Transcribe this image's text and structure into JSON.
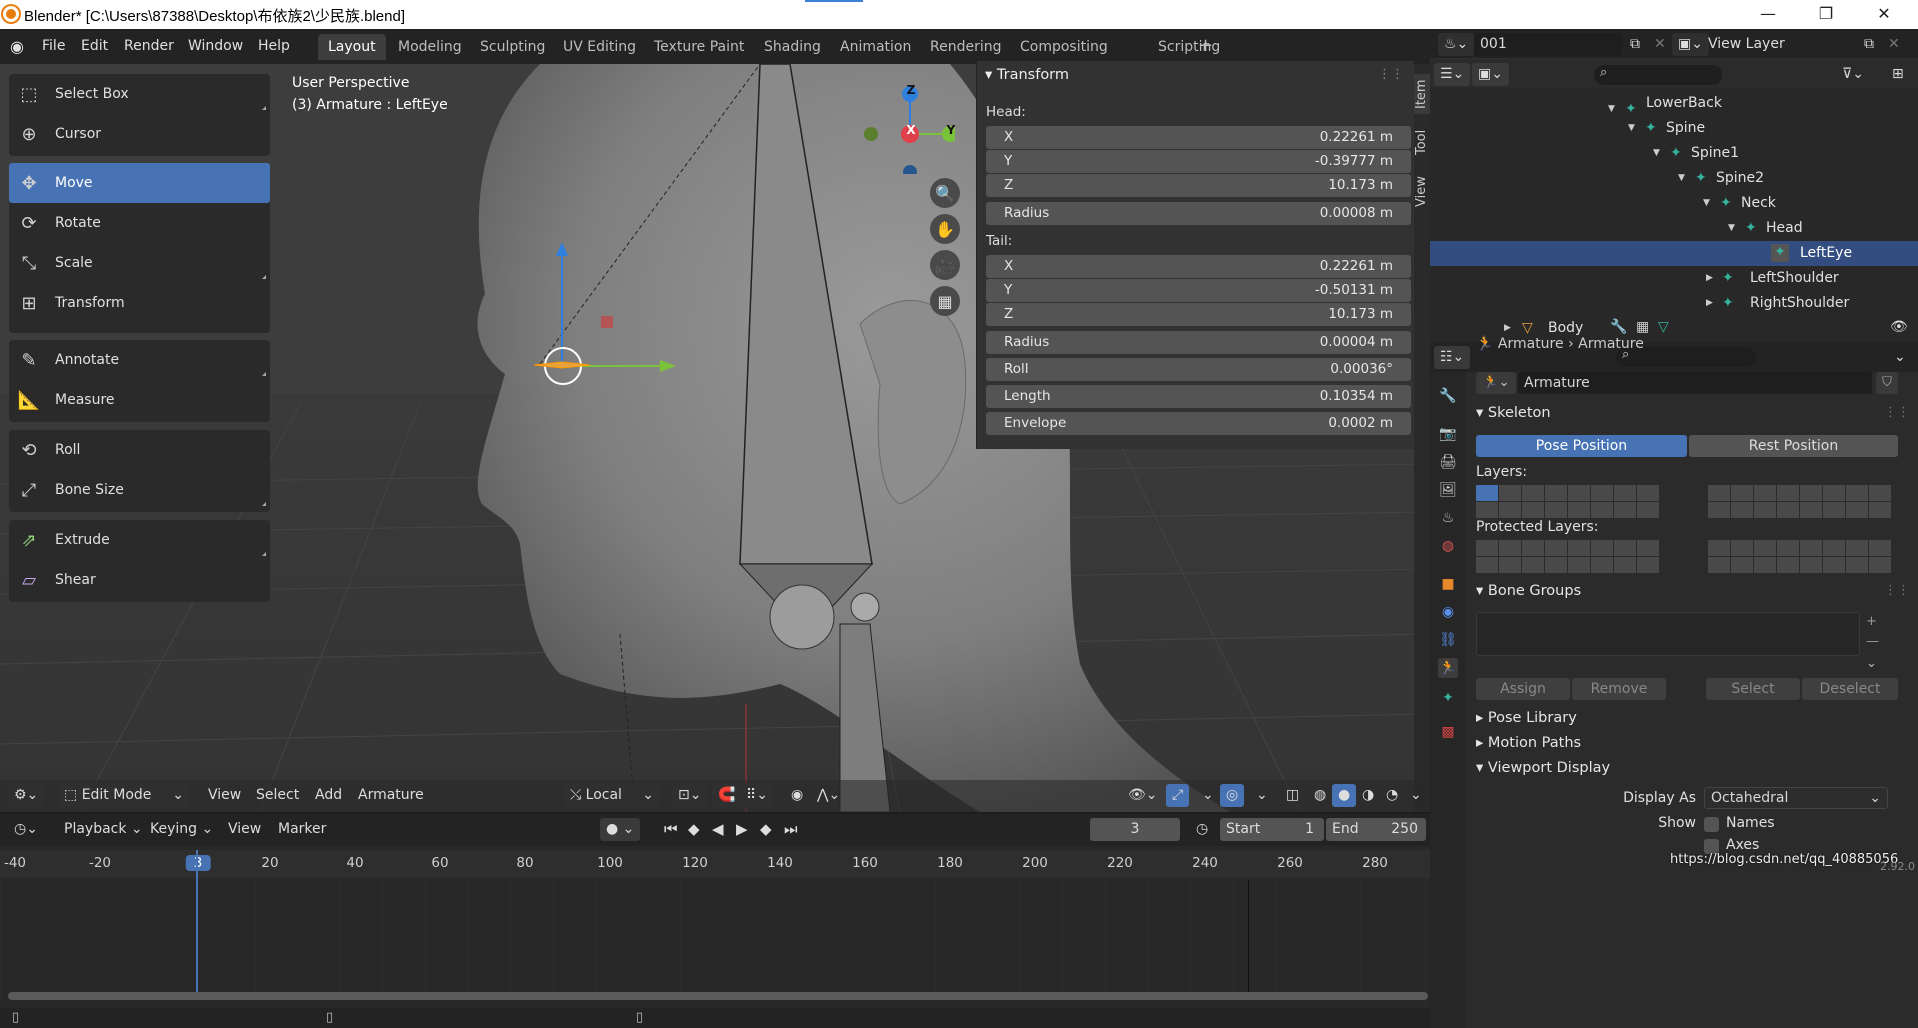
{
  "window": {
    "title": "Blender* [C:\\Users\\87388\\Desktop\\布依族2\\少民族.blend]",
    "controls": [
      "—",
      "❐",
      "✕"
    ]
  },
  "menu": [
    "File",
    "Edit",
    "Render",
    "Window",
    "Help"
  ],
  "workspaces": [
    "Layout",
    "Modeling",
    "Sculpting",
    "UV Editing",
    "Texture Paint",
    "Shading",
    "Animation",
    "Rendering",
    "Compositing",
    "Scripting"
  ],
  "active_workspace": "Layout",
  "scene": {
    "name": "001",
    "view_layer": "View Layer"
  },
  "tools": [
    {
      "label": "Select Box",
      "icon": "select-box-icon"
    },
    {
      "label": "Cursor",
      "icon": "cursor-icon"
    },
    {
      "label": "Move",
      "icon": "move-icon",
      "active": true
    },
    {
      "label": "Rotate",
      "icon": "rotate-icon"
    },
    {
      "label": "Scale",
      "icon": "scale-icon"
    },
    {
      "label": "Transform",
      "icon": "transform-icon"
    },
    {
      "label": "Annotate",
      "icon": "annotate-icon"
    },
    {
      "label": "Measure",
      "icon": "measure-icon"
    },
    {
      "label": "Roll",
      "icon": "roll-icon"
    },
    {
      "label": "Bone Size",
      "icon": "bone-size-icon"
    },
    {
      "label": "Extrude",
      "icon": "extrude-icon"
    },
    {
      "label": "Shear",
      "icon": "shear-icon"
    }
  ],
  "viewport": {
    "perspective": "User Perspective",
    "object_info": "(3) Armature : LeftEye",
    "gizmo": {
      "x": "X",
      "y": "Y",
      "z": "Z"
    }
  },
  "transform_panel": {
    "title": "Transform",
    "head_label": "Head:",
    "head": [
      {
        "k": "X",
        "v": "0.22261 m"
      },
      {
        "k": "Y",
        "v": "-0.39777 m"
      },
      {
        "k": "Z",
        "v": "10.173 m"
      },
      {
        "k": "Radius",
        "v": "0.00008 m"
      }
    ],
    "tail_label": "Tail:",
    "tail": [
      {
        "k": "X",
        "v": "0.22261 m"
      },
      {
        "k": "Y",
        "v": "-0.50131 m"
      },
      {
        "k": "Z",
        "v": "10.173 m"
      },
      {
        "k": "Radius",
        "v": "0.00004 m"
      },
      {
        "k": "Roll",
        "v": "0.00036°"
      },
      {
        "k": "Length",
        "v": "0.10354 m"
      },
      {
        "k": "Envelope",
        "v": "0.0002 m"
      }
    ]
  },
  "side_tabs": [
    "Item",
    "Tool",
    "View"
  ],
  "viewport_header": {
    "mode": "Edit Mode",
    "menus": [
      "View",
      "Select",
      "Add",
      "Armature"
    ],
    "orientation": "Local"
  },
  "timeline": {
    "menus": [
      "Playback",
      "Keying",
      "View",
      "Marker"
    ],
    "current_frame": "3",
    "start_label": "Start",
    "start": "1",
    "end_label": "End",
    "end": "250",
    "ticks": [
      "-40",
      "-20",
      "3",
      "20",
      "40",
      "60",
      "80",
      "100",
      "120",
      "140",
      "160",
      "180",
      "200",
      "220",
      "240",
      "260",
      "280"
    ]
  },
  "outliner": {
    "rows": [
      {
        "label": "LowerBack",
        "depth": 0,
        "type": "bone"
      },
      {
        "label": "Spine",
        "depth": 1,
        "type": "bone"
      },
      {
        "label": "Spine1",
        "depth": 2,
        "type": "bone"
      },
      {
        "label": "Spine2",
        "depth": 3,
        "type": "bone"
      },
      {
        "label": "Neck",
        "depth": 4,
        "type": "bone"
      },
      {
        "label": "Head",
        "depth": 5,
        "type": "bone"
      },
      {
        "label": "LeftEye",
        "depth": 6,
        "type": "bone",
        "selected": true
      },
      {
        "label": "LeftShoulder",
        "depth": 5,
        "type": "bone"
      },
      {
        "label": "RightShoulder",
        "depth": 5,
        "type": "bone"
      },
      {
        "label": "Body",
        "depth": 0,
        "type": "object"
      }
    ]
  },
  "properties": {
    "breadcrumb": [
      "Armature",
      "Armature"
    ],
    "data_name": "Armature",
    "skeleton": {
      "title": "Skeleton",
      "pose_position": "Pose Position",
      "rest_position": "Rest Position",
      "layers_label": "Layers:",
      "protected_label": "Protected Layers:"
    },
    "bone_groups": {
      "title": "Bone Groups",
      "assign": "Assign",
      "remove": "Remove",
      "select": "Select",
      "deselect": "Deselect"
    },
    "collapsed_sections": [
      "Pose Library",
      "Motion Paths"
    ],
    "viewport_display": {
      "title": "Viewport Display",
      "display_as_label": "Display As",
      "display_as": "Octahedral",
      "show_label": "Show",
      "names": "Names",
      "axes": "Axes"
    }
  },
  "statusbar": {
    "watermark": "https://blog.csdn.net/qq_40885056",
    "version": "2.92.0"
  }
}
